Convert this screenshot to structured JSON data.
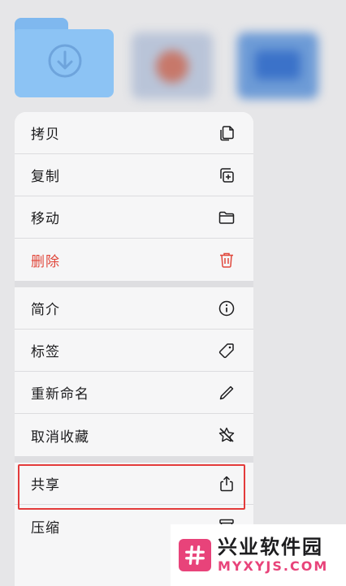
{
  "menu": {
    "groups": [
      {
        "items": [
          {
            "label": "拷贝",
            "icon": "copy-icon"
          },
          {
            "label": "复制",
            "icon": "duplicate-icon"
          },
          {
            "label": "移动",
            "icon": "folder-icon"
          },
          {
            "label": "删除",
            "icon": "trash-icon",
            "destructive": true
          }
        ]
      },
      {
        "items": [
          {
            "label": "简介",
            "icon": "info-icon"
          },
          {
            "label": "标签",
            "icon": "tag-icon"
          },
          {
            "label": "重新命名",
            "icon": "pencil-icon"
          },
          {
            "label": "取消收藏",
            "icon": "star-slash-icon"
          }
        ]
      },
      {
        "items": [
          {
            "label": "共享",
            "icon": "share-icon",
            "highlighted": true
          },
          {
            "label": "压缩",
            "icon": "archive-icon"
          }
        ]
      }
    ]
  },
  "watermark": {
    "title": "兴业软件园",
    "domain": "MYXYJS.COM"
  },
  "colors": {
    "destructive": "#e0473b",
    "highlight_border": "#e33b3b",
    "folder": "#8cc3f4",
    "watermark_accent": "#e8437a"
  }
}
